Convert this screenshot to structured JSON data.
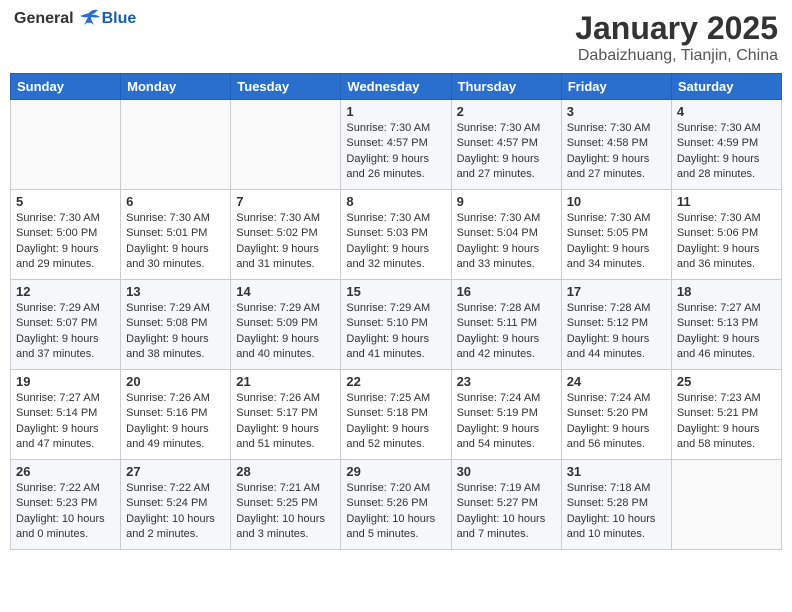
{
  "header": {
    "logo_general": "General",
    "logo_blue": "Blue",
    "month_title": "January 2025",
    "location": "Dabaizhuang, Tianjin, China"
  },
  "weekdays": [
    "Sunday",
    "Monday",
    "Tuesday",
    "Wednesday",
    "Thursday",
    "Friday",
    "Saturday"
  ],
  "weeks": [
    [
      {
        "day": "",
        "info": ""
      },
      {
        "day": "",
        "info": ""
      },
      {
        "day": "",
        "info": ""
      },
      {
        "day": "1",
        "info": "Sunrise: 7:30 AM\nSunset: 4:57 PM\nDaylight: 9 hours and 26 minutes."
      },
      {
        "day": "2",
        "info": "Sunrise: 7:30 AM\nSunset: 4:57 PM\nDaylight: 9 hours and 27 minutes."
      },
      {
        "day": "3",
        "info": "Sunrise: 7:30 AM\nSunset: 4:58 PM\nDaylight: 9 hours and 27 minutes."
      },
      {
        "day": "4",
        "info": "Sunrise: 7:30 AM\nSunset: 4:59 PM\nDaylight: 9 hours and 28 minutes."
      }
    ],
    [
      {
        "day": "5",
        "info": "Sunrise: 7:30 AM\nSunset: 5:00 PM\nDaylight: 9 hours and 29 minutes."
      },
      {
        "day": "6",
        "info": "Sunrise: 7:30 AM\nSunset: 5:01 PM\nDaylight: 9 hours and 30 minutes."
      },
      {
        "day": "7",
        "info": "Sunrise: 7:30 AM\nSunset: 5:02 PM\nDaylight: 9 hours and 31 minutes."
      },
      {
        "day": "8",
        "info": "Sunrise: 7:30 AM\nSunset: 5:03 PM\nDaylight: 9 hours and 32 minutes."
      },
      {
        "day": "9",
        "info": "Sunrise: 7:30 AM\nSunset: 5:04 PM\nDaylight: 9 hours and 33 minutes."
      },
      {
        "day": "10",
        "info": "Sunrise: 7:30 AM\nSunset: 5:05 PM\nDaylight: 9 hours and 34 minutes."
      },
      {
        "day": "11",
        "info": "Sunrise: 7:30 AM\nSunset: 5:06 PM\nDaylight: 9 hours and 36 minutes."
      }
    ],
    [
      {
        "day": "12",
        "info": "Sunrise: 7:29 AM\nSunset: 5:07 PM\nDaylight: 9 hours and 37 minutes."
      },
      {
        "day": "13",
        "info": "Sunrise: 7:29 AM\nSunset: 5:08 PM\nDaylight: 9 hours and 38 minutes."
      },
      {
        "day": "14",
        "info": "Sunrise: 7:29 AM\nSunset: 5:09 PM\nDaylight: 9 hours and 40 minutes."
      },
      {
        "day": "15",
        "info": "Sunrise: 7:29 AM\nSunset: 5:10 PM\nDaylight: 9 hours and 41 minutes."
      },
      {
        "day": "16",
        "info": "Sunrise: 7:28 AM\nSunset: 5:11 PM\nDaylight: 9 hours and 42 minutes."
      },
      {
        "day": "17",
        "info": "Sunrise: 7:28 AM\nSunset: 5:12 PM\nDaylight: 9 hours and 44 minutes."
      },
      {
        "day": "18",
        "info": "Sunrise: 7:27 AM\nSunset: 5:13 PM\nDaylight: 9 hours and 46 minutes."
      }
    ],
    [
      {
        "day": "19",
        "info": "Sunrise: 7:27 AM\nSunset: 5:14 PM\nDaylight: 9 hours and 47 minutes."
      },
      {
        "day": "20",
        "info": "Sunrise: 7:26 AM\nSunset: 5:16 PM\nDaylight: 9 hours and 49 minutes."
      },
      {
        "day": "21",
        "info": "Sunrise: 7:26 AM\nSunset: 5:17 PM\nDaylight: 9 hours and 51 minutes."
      },
      {
        "day": "22",
        "info": "Sunrise: 7:25 AM\nSunset: 5:18 PM\nDaylight: 9 hours and 52 minutes."
      },
      {
        "day": "23",
        "info": "Sunrise: 7:24 AM\nSunset: 5:19 PM\nDaylight: 9 hours and 54 minutes."
      },
      {
        "day": "24",
        "info": "Sunrise: 7:24 AM\nSunset: 5:20 PM\nDaylight: 9 hours and 56 minutes."
      },
      {
        "day": "25",
        "info": "Sunrise: 7:23 AM\nSunset: 5:21 PM\nDaylight: 9 hours and 58 minutes."
      }
    ],
    [
      {
        "day": "26",
        "info": "Sunrise: 7:22 AM\nSunset: 5:23 PM\nDaylight: 10 hours and 0 minutes."
      },
      {
        "day": "27",
        "info": "Sunrise: 7:22 AM\nSunset: 5:24 PM\nDaylight: 10 hours and 2 minutes."
      },
      {
        "day": "28",
        "info": "Sunrise: 7:21 AM\nSunset: 5:25 PM\nDaylight: 10 hours and 3 minutes."
      },
      {
        "day": "29",
        "info": "Sunrise: 7:20 AM\nSunset: 5:26 PM\nDaylight: 10 hours and 5 minutes."
      },
      {
        "day": "30",
        "info": "Sunrise: 7:19 AM\nSunset: 5:27 PM\nDaylight: 10 hours and 7 minutes."
      },
      {
        "day": "31",
        "info": "Sunrise: 7:18 AM\nSunset: 5:28 PM\nDaylight: 10 hours and 10 minutes."
      },
      {
        "day": "",
        "info": ""
      }
    ]
  ]
}
